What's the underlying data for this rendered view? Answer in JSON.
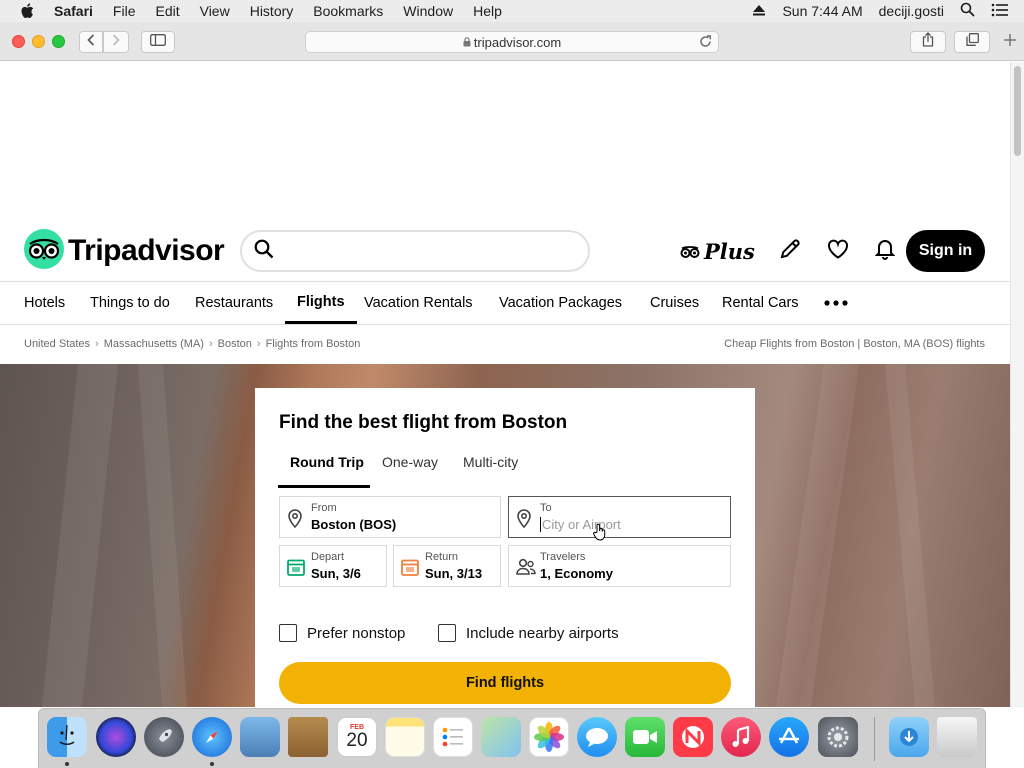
{
  "menubar": {
    "app": "Safari",
    "items": [
      "File",
      "Edit",
      "View",
      "History",
      "Bookmarks",
      "Window",
      "Help"
    ],
    "clock": "Sun 7:44 AM",
    "user": "deciji.gosti"
  },
  "browser": {
    "url": "tripadvisor.com"
  },
  "site": {
    "logo_text": "Tripadvisor",
    "plus_label": "Plus",
    "signin_label": "Sign in",
    "nav": [
      "Hotels",
      "Things to do",
      "Restaurants",
      "Flights",
      "Vacation Rentals",
      "Vacation Packages",
      "Cruises",
      "Rental Cars"
    ],
    "active_nav": "Flights",
    "breadcrumbs": [
      "United States",
      "Massachusetts (MA)",
      "Boston",
      "Flights from Boston"
    ],
    "breadcrumb_right": "Cheap Flights from Boston | Boston, MA (BOS) flights"
  },
  "flight_search": {
    "title": "Find the best flight from Boston",
    "tabs": [
      "Round Trip",
      "One-way",
      "Multi-city"
    ],
    "active_tab": "Round Trip",
    "from": {
      "label": "From",
      "value": "Boston (BOS)"
    },
    "to": {
      "label": "To",
      "placeholder": "City or Airport"
    },
    "depart": {
      "label": "Depart",
      "value": "Sun, 3/6"
    },
    "return": {
      "label": "Return",
      "value": "Sun, 3/13"
    },
    "travelers": {
      "label": "Travelers",
      "value": "1, Economy"
    },
    "prefer_nonstop": "Prefer nonstop",
    "include_nearby": "Include nearby airports",
    "submit": "Find flights"
  },
  "colors": {
    "brand_green": "#34e0a1",
    "cta_yellow": "#f2b203",
    "signin_bg": "#000000",
    "calendar_green": "#00aa6c",
    "calendar_orange": "#f0803c"
  },
  "dock": {
    "calendar_month": "FEB",
    "calendar_day": "20"
  }
}
